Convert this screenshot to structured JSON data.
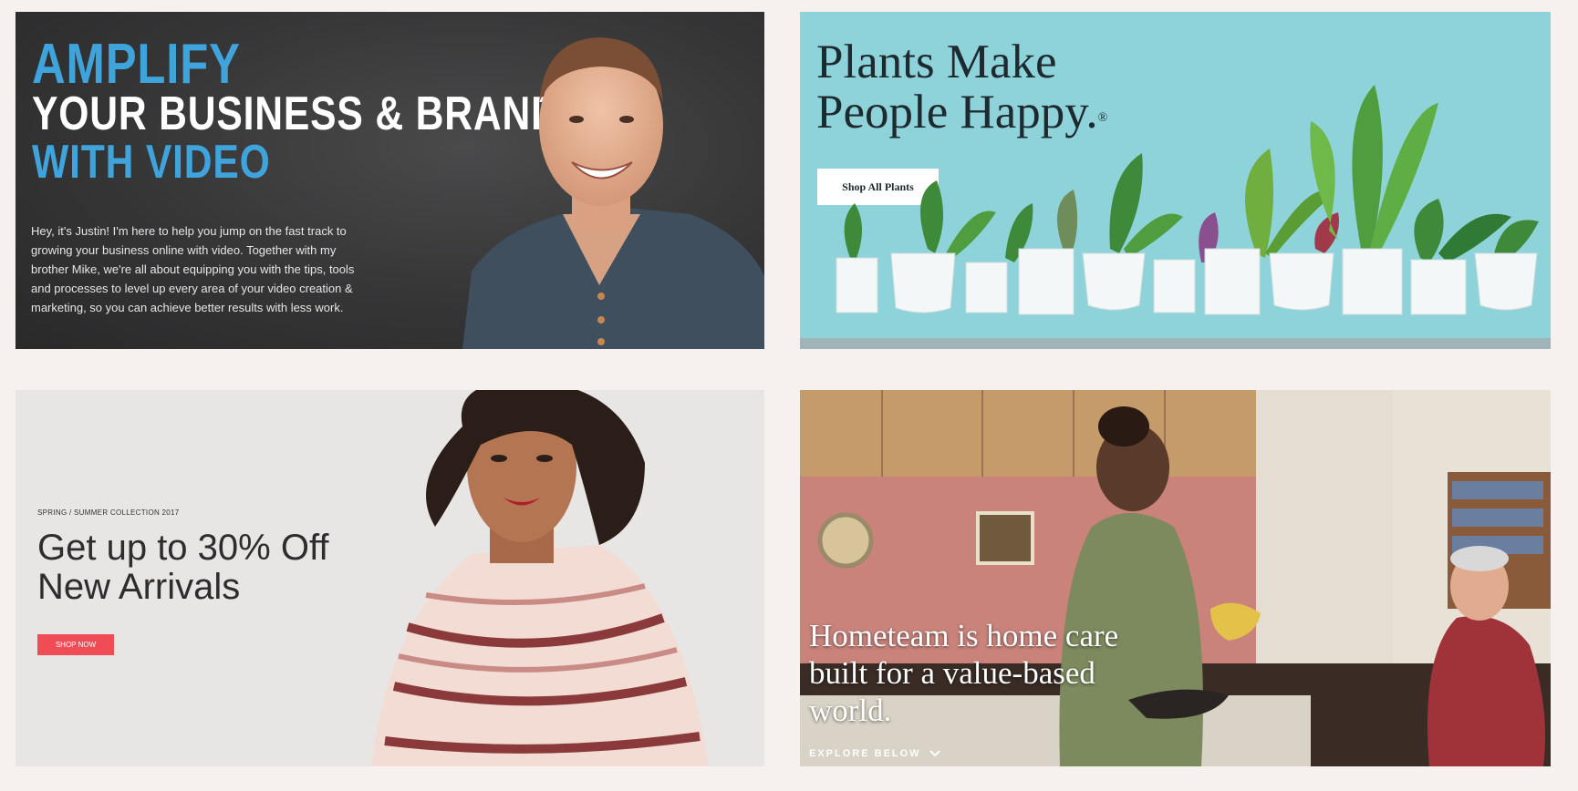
{
  "cards": [
    {
      "headline_1": "AMPLIFY",
      "headline_2": "YOUR BUSINESS & BRAND",
      "headline_3": "WITH VIDEO",
      "body_lines": [
        "Hey, it's Justin! I'm here to help you jump on the fast track to",
        "growing your business online with video. Together with my",
        "brother Mike, we're all about equipping you with the tips, tools",
        "and processes to level up every area of your video creation &",
        "marketing, so you can achieve better results with less work."
      ]
    },
    {
      "title_line_1": "Plants Make",
      "title_line_2": "People Happy.",
      "title_mark": "®",
      "button_label": "Shop All Plants"
    },
    {
      "eyebrow": "SPRING / SUMMER COLLECTION 2017",
      "headline_line_1": "Get up to 30% Off",
      "headline_line_2": "New Arrivals",
      "button_label": "SHOP NOW"
    },
    {
      "headline_line_1": "Hometeam is home care",
      "headline_line_2": "built for a value-based",
      "headline_line_3": "world.",
      "explore_label": "EXPLORE BELOW",
      "explore_icon": "chevron-down-icon"
    }
  ],
  "colors": {
    "page_bg": "#f6f1ef",
    "accent_blue": "#3fa3dc",
    "plants_bg": "#8fd3da",
    "shop_now_red": "#f04c55"
  }
}
